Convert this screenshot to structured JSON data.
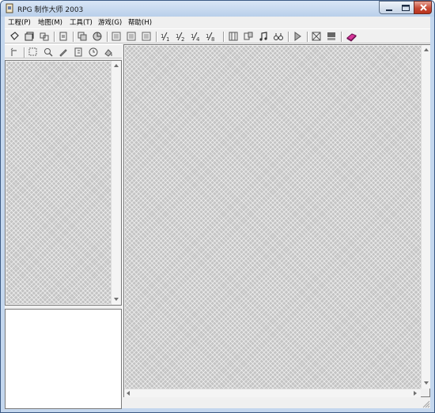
{
  "window": {
    "title": "RPG 制作大师 2003"
  },
  "menu": [
    {
      "label": "工程(P)"
    },
    {
      "label": "地图(M)"
    },
    {
      "label": "工具(T)"
    },
    {
      "label": "游戏(G)"
    },
    {
      "label": "帮助(H)"
    }
  ],
  "toolbar_main": {
    "icons": [
      "new-project-icon",
      "open-project-icon",
      "close-project-icon",
      "import-icon",
      "cut-icon",
      "copy-icon",
      "layer-lower-icon",
      "layer-upper-icon",
      "event-layer-icon",
      "zoom-1-1-icon",
      "zoom-1-2-icon",
      "zoom-1-4-icon",
      "zoom-1-8-icon",
      "database-icon",
      "material-icon",
      "music-icon",
      "search-icon",
      "play-test-icon",
      "fullscreen-icon",
      "title-screen-icon",
      "help-book-icon"
    ]
  },
  "toolbar_tools": {
    "icons": [
      "undo-icon",
      "select-icon",
      "zoom-icon",
      "pencil-icon",
      "rectangle-icon",
      "circle-icon",
      "fill-icon"
    ]
  },
  "colors": {
    "titlebar": "#c4d7ee",
    "tile_checker": "#c3c3c3",
    "close_button": "#c74a35"
  }
}
